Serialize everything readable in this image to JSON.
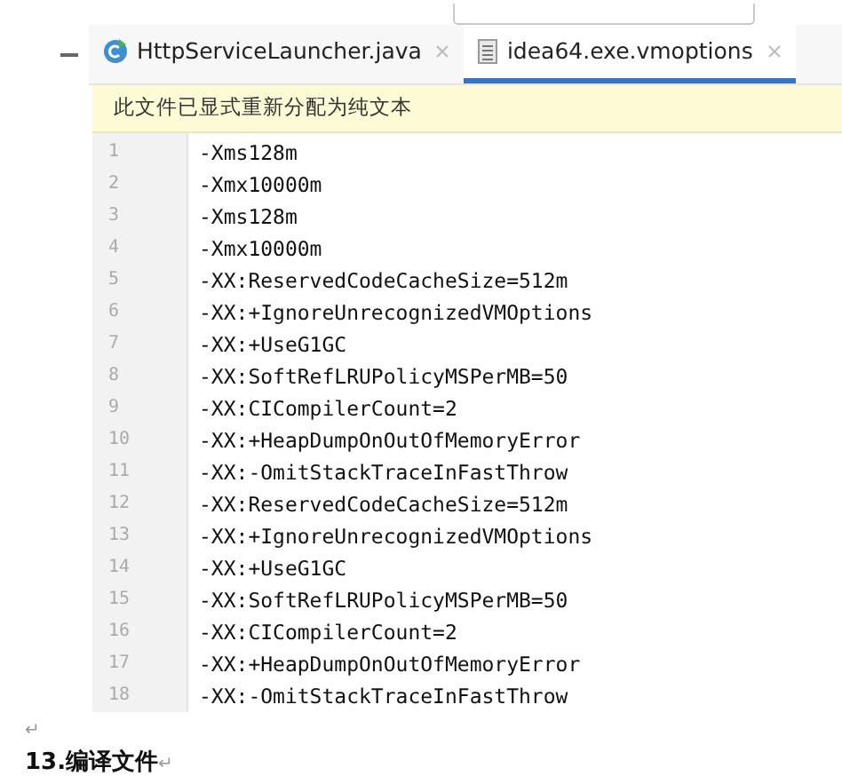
{
  "tabs": [
    {
      "label": "HttpServiceLauncher.java",
      "kind": "java",
      "selected": false
    },
    {
      "label": "idea64.exe.vmoptions",
      "kind": "text",
      "selected": true
    }
  ],
  "banner": "此文件已显式重新分配为纯文本",
  "lines": [
    {
      "number": "1",
      "text": "-Xms128m"
    },
    {
      "number": "2",
      "text": "-Xmx10000m"
    },
    {
      "number": "3",
      "text": "-Xms128m"
    },
    {
      "number": "4",
      "text": "-Xmx10000m"
    },
    {
      "number": "5",
      "text": "-XX:ReservedCodeCacheSize=512m"
    },
    {
      "number": "6",
      "text": "-XX:+IgnoreUnrecognizedVMOptions"
    },
    {
      "number": "7",
      "text": "-XX:+UseG1GC"
    },
    {
      "number": "8",
      "text": "-XX:SoftRefLRUPolicyMSPerMB=50"
    },
    {
      "number": "9",
      "text": "-XX:CICompilerCount=2"
    },
    {
      "number": "10",
      "text": "-XX:+HeapDumpOnOutOfMemoryError"
    },
    {
      "number": "11",
      "text": "-XX:-OmitStackTraceInFastThrow"
    },
    {
      "number": "12",
      "text": "-XX:ReservedCodeCacheSize=512m"
    },
    {
      "number": "13",
      "text": "-XX:+IgnoreUnrecognizedVMOptions"
    },
    {
      "number": "14",
      "text": "-XX:+UseG1GC"
    },
    {
      "number": "15",
      "text": "-XX:SoftRefLRUPolicyMSPerMB=50"
    },
    {
      "number": "16",
      "text": "-XX:CICompilerCount=2"
    },
    {
      "number": "17",
      "text": "-XX:+HeapDumpOnOutOfMemoryError"
    },
    {
      "number": "18",
      "text": "-XX:-OmitStackTraceInFastThrow"
    }
  ],
  "doc": {
    "blank_mark": "↵",
    "heading": "13.编译文件",
    "heading_mark": "↵"
  }
}
